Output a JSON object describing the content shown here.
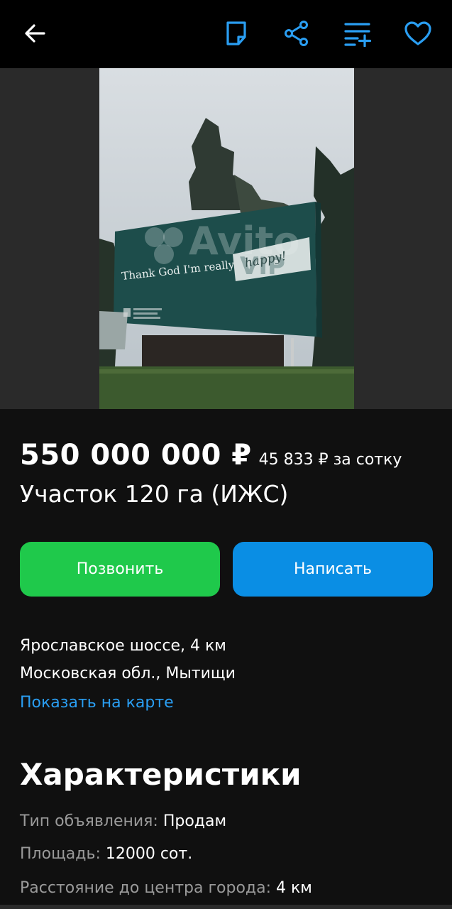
{
  "topbar": {
    "icons": [
      "back-arrow-icon",
      "note-icon",
      "share-icon",
      "compare-list-icon",
      "heart-icon"
    ],
    "accent": "#2a9ef2"
  },
  "photo": {
    "billboard_text": "Thank God I'm really",
    "billboard_script": "happy!",
    "billboard_emboss": "VIP",
    "watermark": "Avito"
  },
  "listing": {
    "price": "550 000 000 ₽",
    "price_per": "45 833 ₽ за сотку",
    "title": "Участок 120 га (ИЖС)"
  },
  "actions": {
    "call_label": "Позвонить",
    "write_label": "Написать",
    "call_color": "#1fc94b",
    "write_color": "#0a8ee4"
  },
  "location": {
    "line1": "Ярославское шоссе, 4 км",
    "line2": "Московская обл., Мытищи",
    "map_link": "Показать на карте"
  },
  "characteristics": {
    "title": "Характеристики",
    "items": [
      {
        "key": "Тип объявления: ",
        "value": "Продам"
      },
      {
        "key": "Площадь: ",
        "value": "12000 сот."
      },
      {
        "key": "Расстояние до центра города: ",
        "value": "4 км"
      }
    ]
  }
}
